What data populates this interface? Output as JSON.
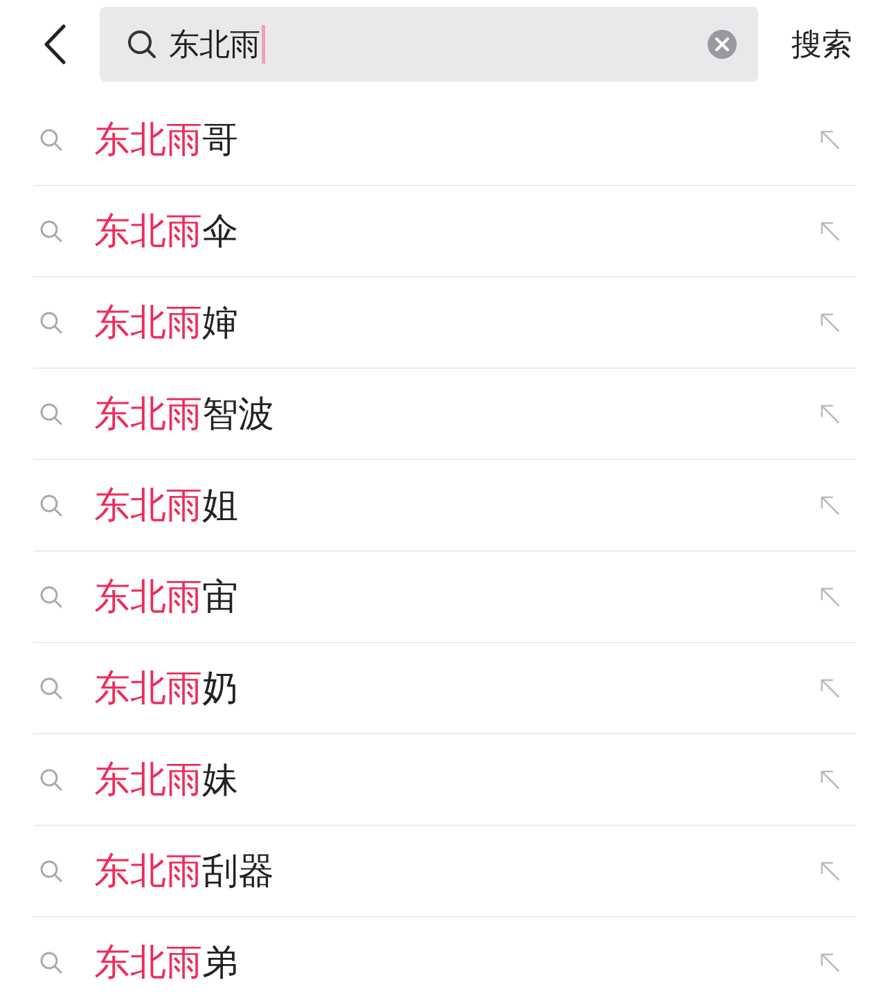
{
  "search": {
    "value": "东北雨",
    "submit_label": "搜索"
  },
  "suggestions": [
    {
      "match": "东北雨",
      "rest": "哥"
    },
    {
      "match": "东北雨",
      "rest": "伞"
    },
    {
      "match": "东北雨",
      "rest": "婶"
    },
    {
      "match": "东北雨",
      "rest": "智波"
    },
    {
      "match": "东北雨",
      "rest": "姐"
    },
    {
      "match": "东北雨",
      "rest": "宙"
    },
    {
      "match": "东北雨",
      "rest": "奶"
    },
    {
      "match": "东北雨",
      "rest": "妹"
    },
    {
      "match": "东北雨",
      "rest": "刮器"
    },
    {
      "match": "东北雨",
      "rest": "弟"
    }
  ]
}
